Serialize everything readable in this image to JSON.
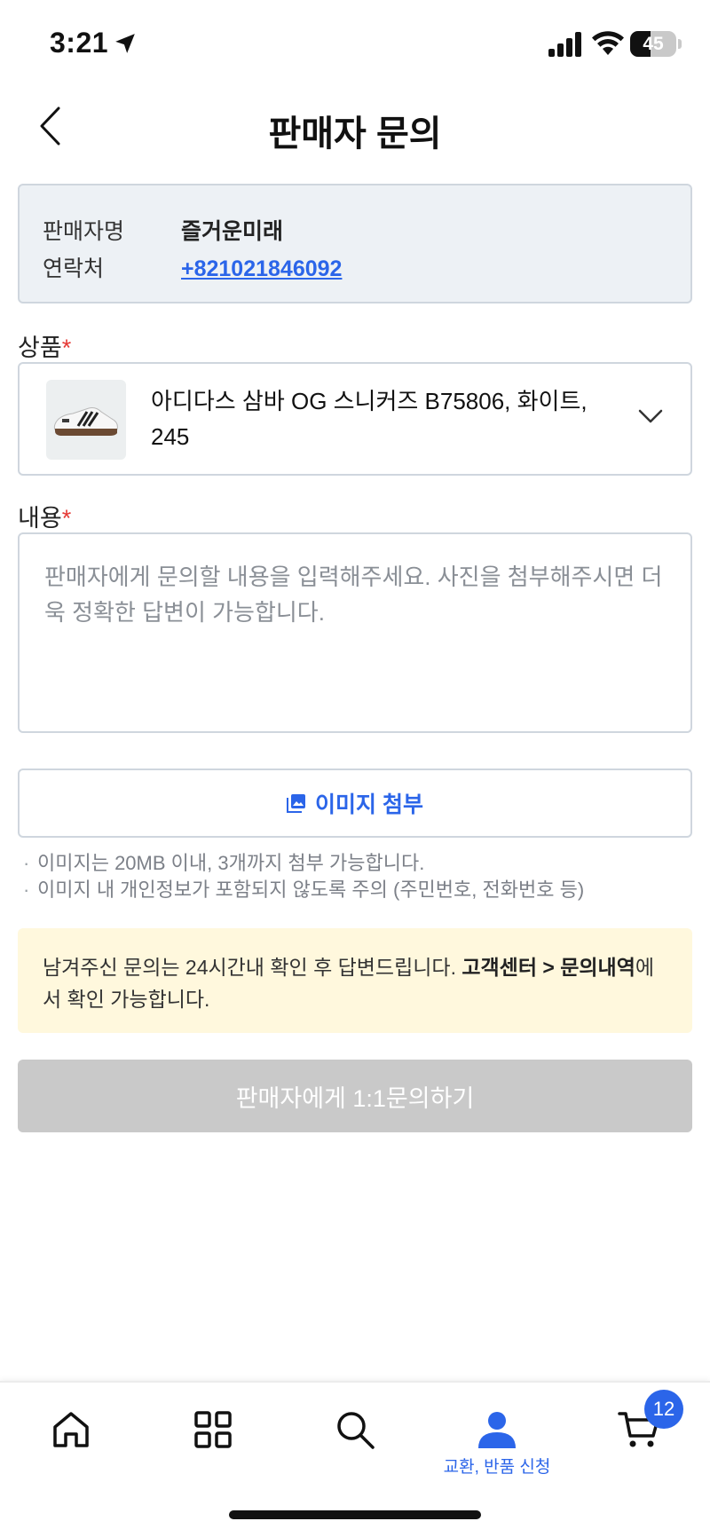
{
  "status_bar": {
    "time": "3:21",
    "battery": "45",
    "battery_level": 0.45
  },
  "header": {
    "title": "판매자 문의",
    "back_icon": "chevron-left-icon"
  },
  "seller": {
    "name_label": "판매자명",
    "name_value": "즐거운미래",
    "contact_label": "연락처",
    "contact_value": "+821021846092"
  },
  "product": {
    "label": "상품",
    "required_mark": "*",
    "name": "아디다스 삼바 OG 스니커즈 B75806, 화이트, 245"
  },
  "content": {
    "label": "내용",
    "required_mark": "*",
    "placeholder": "판매자에게 문의할 내용을 입력해주세요. 사진을 첨부해주시면 더욱 정확한 답변이 가능합니다.",
    "value": ""
  },
  "attach": {
    "label": "이미지 첨부",
    "notes": [
      "이미지는 20MB 이내, 3개까지 첨부 가능합니다.",
      "이미지 내 개인정보가 포함되지 않도록 주의 (주민번호, 전화번호 등)"
    ]
  },
  "notice": {
    "text_before": "남겨주신 문의는 24시간내 확인 후 답변드립니다. ",
    "bold": "고객센터 > 문의내역",
    "text_after": "에서 확인 가능합니다."
  },
  "submit": {
    "label": "판매자에게 1:1문의하기"
  },
  "bottom_nav": {
    "items": [
      {
        "icon": "home-icon",
        "label": ""
      },
      {
        "icon": "grid-icon",
        "label": ""
      },
      {
        "icon": "search-icon",
        "label": ""
      },
      {
        "icon": "user-icon",
        "label": "교환, 반품 신청"
      },
      {
        "icon": "cart-icon",
        "label": ""
      }
    ],
    "cart_count": "12"
  },
  "colors": {
    "accent": "#2b65e9",
    "required": "#e53935",
    "notice_bg": "#fff8dd",
    "disabled_button": "#c9c9c9",
    "info_box_bg": "#edf1f5"
  }
}
